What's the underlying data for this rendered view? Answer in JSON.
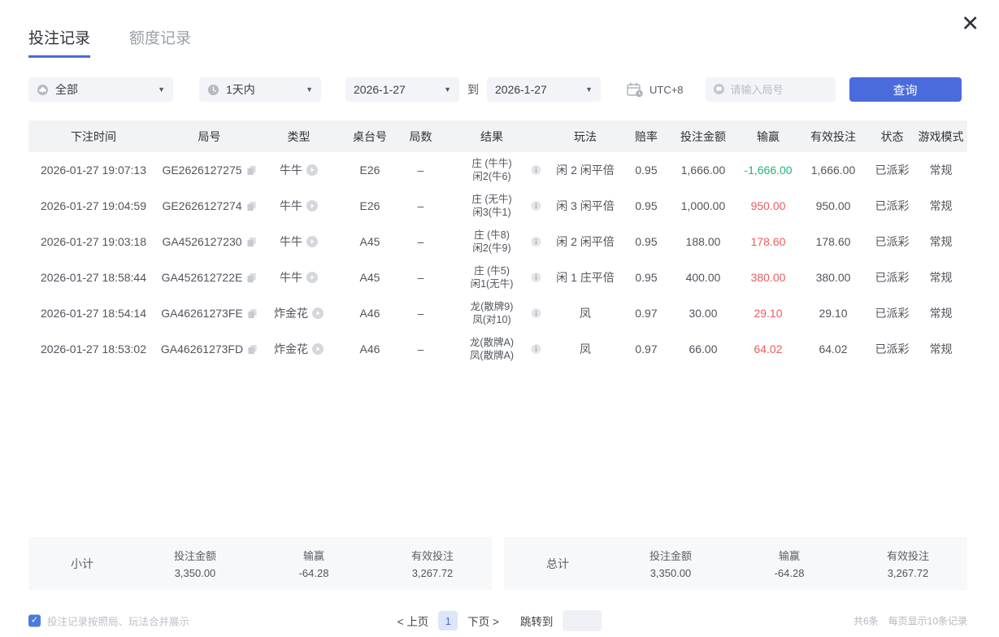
{
  "window": {
    "close_icon": "✕"
  },
  "tabs": [
    {
      "label": "投注记录",
      "active": true
    },
    {
      "label": "额度记录",
      "active": false
    }
  ],
  "filters": {
    "type_value": "全部",
    "time_value": "1天内",
    "date_from": "2026-1-27",
    "to_label": "到",
    "date_to": "2026-1-27",
    "timezone": "UTC+8",
    "search_placeholder": "请输入局号",
    "query_button": "查询"
  },
  "table": {
    "headers": [
      "下注时间",
      "局号",
      "类型",
      "桌台号",
      "局数",
      "结果",
      "玩法",
      "赔率",
      "投注金额",
      "输赢",
      "有效投注",
      "状态",
      "游戏模式"
    ],
    "rows": [
      {
        "time": "2026-01-27 19:07:13",
        "round_id": "GE2626127275",
        "type": "牛牛",
        "table_no": "E26",
        "rounds": "–",
        "result1": "庄 (牛牛)",
        "result2": "闲2(牛6)",
        "play": "闲 2 闲平倍",
        "odds": "0.95",
        "bet_amount": "1,666.00",
        "win_loss": "-1,666.00",
        "win_loss_color": "green",
        "valid_bet": "1,666.00",
        "status": "已派彩",
        "mode": "常规"
      },
      {
        "time": "2026-01-27 19:04:59",
        "round_id": "GE2626127274",
        "type": "牛牛",
        "table_no": "E26",
        "rounds": "–",
        "result1": "庄 (无牛)",
        "result2": "闲3(牛1)",
        "play": "闲 3 闲平倍",
        "odds": "0.95",
        "bet_amount": "1,000.00",
        "win_loss": "950.00",
        "win_loss_color": "red",
        "valid_bet": "950.00",
        "status": "已派彩",
        "mode": "常规"
      },
      {
        "time": "2026-01-27 19:03:18",
        "round_id": "GA4526127230",
        "type": "牛牛",
        "table_no": "A45",
        "rounds": "–",
        "result1": "庄 (牛8)",
        "result2": "闲2(牛9)",
        "play": "闲 2 闲平倍",
        "odds": "0.95",
        "bet_amount": "188.00",
        "win_loss": "178.60",
        "win_loss_color": "red",
        "valid_bet": "178.60",
        "status": "已派彩",
        "mode": "常规"
      },
      {
        "time": "2026-01-27 18:58:44",
        "round_id": "GA452612722E",
        "type": "牛牛",
        "table_no": "A45",
        "rounds": "–",
        "result1": "庄 (牛5)",
        "result2": "闲1(无牛)",
        "play": "闲 1 庄平倍",
        "odds": "0.95",
        "bet_amount": "400.00",
        "win_loss": "380.00",
        "win_loss_color": "red",
        "valid_bet": "380.00",
        "status": "已派彩",
        "mode": "常规"
      },
      {
        "time": "2026-01-27 18:54:14",
        "round_id": "GA46261273FE",
        "type": "炸金花",
        "table_no": "A46",
        "rounds": "–",
        "result1": "龙(散牌9)",
        "result2": "凤(对10)",
        "play": "凤",
        "odds": "0.97",
        "bet_amount": "30.00",
        "win_loss": "29.10",
        "win_loss_color": "red",
        "valid_bet": "29.10",
        "status": "已派彩",
        "mode": "常规"
      },
      {
        "time": "2026-01-27 18:53:02",
        "round_id": "GA46261273FD",
        "type": "炸金花",
        "table_no": "A46",
        "rounds": "–",
        "result1": "龙(散牌A)",
        "result2": "凤(散牌A)",
        "play": "凤",
        "odds": "0.97",
        "bet_amount": "66.00",
        "win_loss": "64.02",
        "win_loss_color": "red",
        "valid_bet": "64.02",
        "status": "已派彩",
        "mode": "常规"
      }
    ]
  },
  "summary": {
    "subtotal": {
      "label": "小计",
      "bet_label": "投注金额",
      "bet": "3,350.00",
      "winloss_label": "输赢",
      "winloss": "-64.28",
      "valid_label": "有效投注",
      "valid": "3,267.72"
    },
    "total": {
      "label": "总计",
      "bet_label": "投注金额",
      "bet": "3,350.00",
      "winloss_label": "输赢",
      "winloss": "-64.28",
      "valid_label": "有效投注",
      "valid": "3,267.72"
    }
  },
  "footer": {
    "merge_label": "投注记录按照局、玩法合并展示",
    "checkbox_checked": true,
    "pagination": {
      "prev": "< 上页",
      "current_page": "1",
      "next": "下页 >",
      "jump_label": "跳转到"
    },
    "count_text": "共6条",
    "pagesize_text": "每页显示10条记录"
  },
  "colors": {
    "accent_blue": "#4A6BDB",
    "win_red": "#E85C5C",
    "loss_green": "#22B577"
  }
}
